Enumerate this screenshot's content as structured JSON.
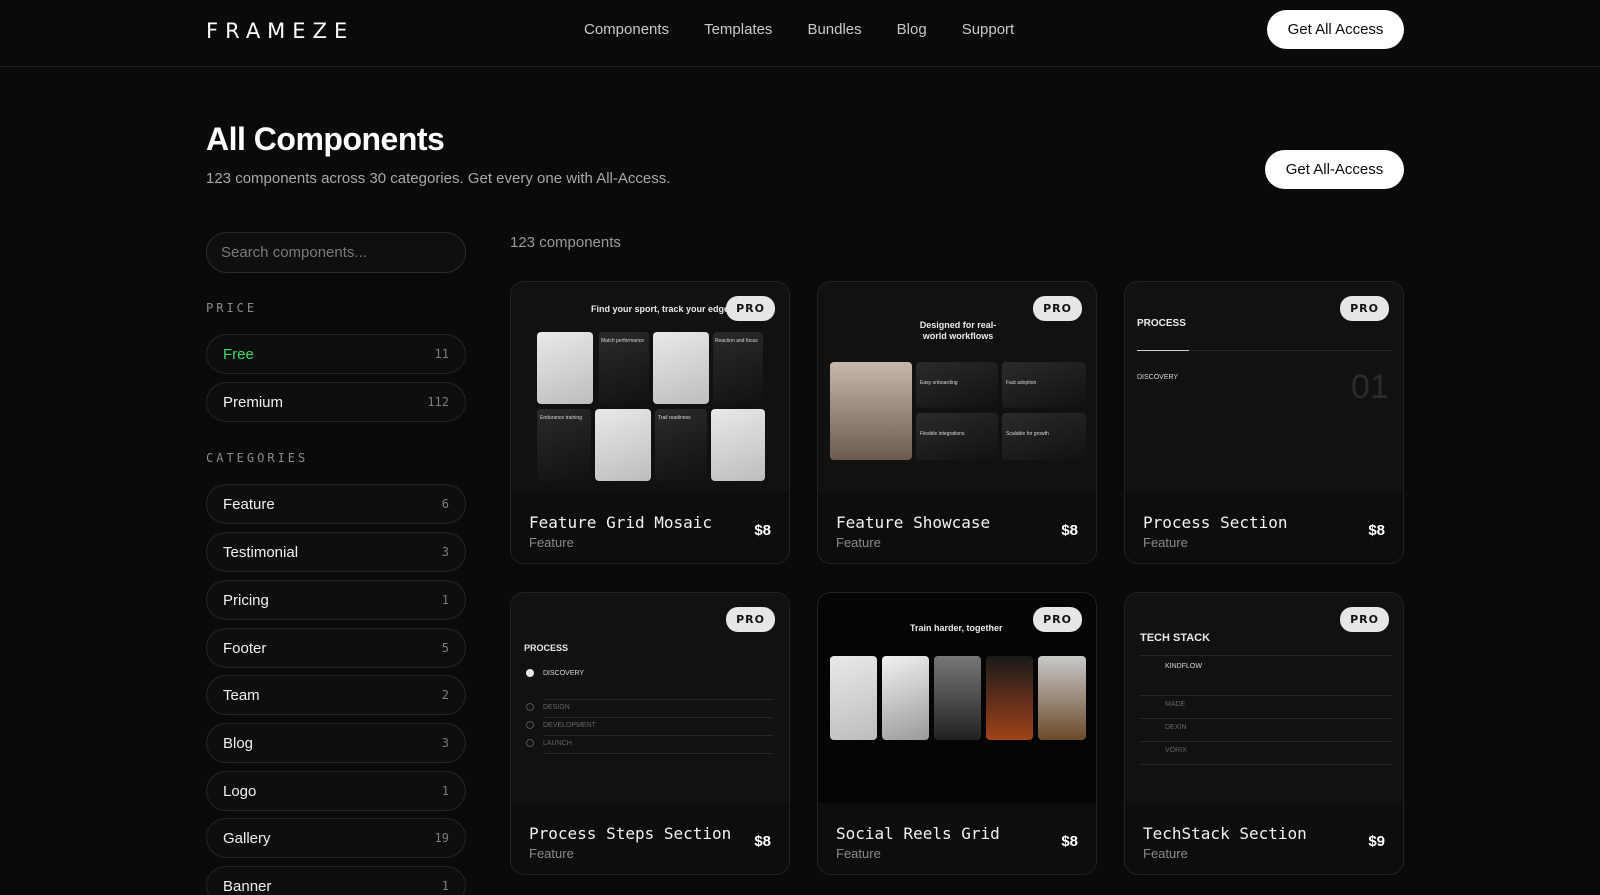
{
  "header": {
    "logo": "FRAMEZE",
    "nav": [
      "Components",
      "Templates",
      "Bundles",
      "Blog",
      "Support"
    ],
    "cta": "Get All Access"
  },
  "hero": {
    "title": "All Components",
    "subtitle": "123 components across 30 categories. Get every one with All-Access.",
    "cta": "Get All-Access"
  },
  "sidebar": {
    "search_placeholder": "Search components...",
    "price_label": "PRICE",
    "price": [
      {
        "name": "Free",
        "count": "11",
        "active": true
      },
      {
        "name": "Premium",
        "count": "112",
        "active": false
      }
    ],
    "categories_label": "CATEGORIES",
    "categories": [
      {
        "name": "Feature",
        "count": "6"
      },
      {
        "name": "Testimonial",
        "count": "3"
      },
      {
        "name": "Pricing",
        "count": "1"
      },
      {
        "name": "Footer",
        "count": "5"
      },
      {
        "name": "Team",
        "count": "2"
      },
      {
        "name": "Blog",
        "count": "3"
      },
      {
        "name": "Logo",
        "count": "1"
      },
      {
        "name": "Gallery",
        "count": "19"
      },
      {
        "name": "Banner",
        "count": "1"
      }
    ]
  },
  "results": {
    "count_label": "123 components"
  },
  "cards": [
    {
      "title": "Feature Grid Mosaic",
      "category": "Feature",
      "price": "$8",
      "badge": "PRO",
      "preview": {
        "heading": "Find your sport, track your edge",
        "labels": [
          "Match performance",
          "Reaction and focus",
          "Endurance training",
          "Trail readiness"
        ]
      }
    },
    {
      "title": "Feature Showcase",
      "category": "Feature",
      "price": "$8",
      "badge": "PRO",
      "preview": {
        "heading": "Designed for real-world workflows",
        "labels": [
          "Easy onboarding",
          "Fast adoption",
          "Flexible integrations",
          "Scalable for growth"
        ]
      }
    },
    {
      "title": "Process Section",
      "category": "Feature",
      "price": "$8",
      "badge": "PRO",
      "preview": {
        "heading": "PROCESS",
        "step": "DISCOVERY",
        "number": "01"
      }
    },
    {
      "title": "Process Steps Section",
      "category": "Feature",
      "price": "$8",
      "badge": "PRO",
      "preview": {
        "heading": "PROCESS",
        "steps": [
          "DISCOVERY",
          "DESIGN",
          "DEVELOPMENT",
          "LAUNCH"
        ]
      }
    },
    {
      "title": "Social Reels Grid",
      "category": "Feature",
      "price": "$8",
      "badge": "PRO",
      "preview": {
        "heading": "Train harder, together"
      }
    },
    {
      "title": "TechStack Section",
      "category": "Feature",
      "price": "$9",
      "badge": "PRO",
      "preview": {
        "heading": "TECH STACK",
        "items": [
          "KINDFLOW",
          "MADE",
          "DEXIN",
          "VORIX"
        ]
      }
    }
  ]
}
